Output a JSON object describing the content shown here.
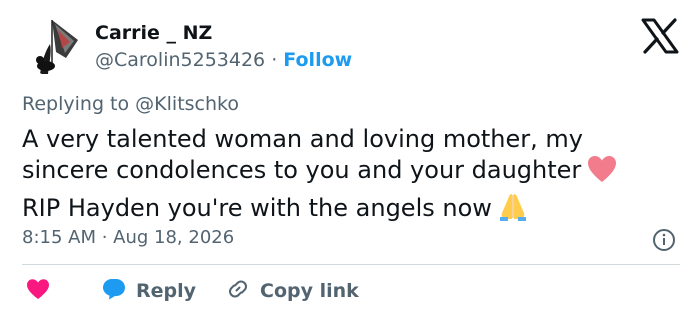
{
  "author": {
    "name": "Carrie _ NZ",
    "handle": "@Carolin5253426",
    "separator": "·",
    "follow_label": "Follow"
  },
  "reply_context": {
    "prefix": "Replying to",
    "mention": "@Klitschko"
  },
  "tweet": {
    "lines": [
      "A very talented woman and loving mother, my",
      "sincere condolences to you and your daughter",
      "RIP Hayden you're with the angels now"
    ],
    "emojis": [
      "heart-emoji",
      "folded-hands-emoji"
    ]
  },
  "timestamp": "8:15 AM · Aug 18, 2026",
  "actions": {
    "reply_label": "Reply",
    "copy_link_label": "Copy link"
  },
  "colors": {
    "accent": "#1d9bf0",
    "like": "#f91880",
    "reply_bubble": "#1d9bf0",
    "muted": "#536471",
    "heart_emoji": "#f27b8c",
    "divider": "#cfd9de"
  },
  "icons": [
    "avatar",
    "x-logo-icon",
    "info-icon",
    "heart-icon",
    "reply-bubble-icon",
    "link-icon"
  ]
}
